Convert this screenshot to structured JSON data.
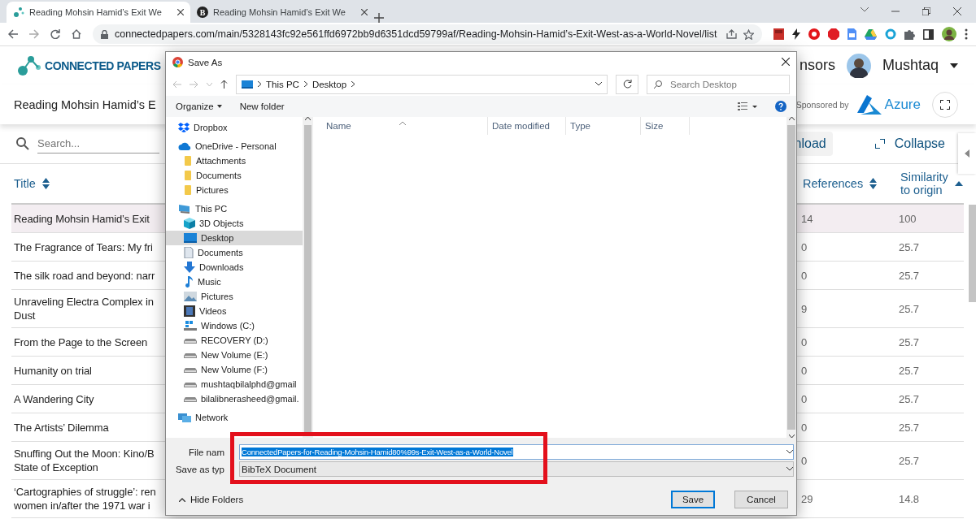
{
  "browser": {
    "tabs": [
      {
        "title": "Reading Mohsin Hamid’s Exit We",
        "selected": true,
        "kind": "graph"
      },
      {
        "title": "Reading Mohsin Hamid’s Exit We",
        "selected": false,
        "kind": "letter",
        "favicon_text": "B"
      }
    ],
    "url": "connectedpapers.com/main/5328143fc92e561ffd6972bb9d6351dcd59799af/Reading-Mohsin-Hamid’s-Exit-West-as-a-World-Novel/list"
  },
  "site": {
    "logo": "CONNECTED PAPERS",
    "nav_link": "nsors",
    "user": "Mushtaq",
    "graph_title": "Reading Mohsin Hamid’s E",
    "sponsor_label": "Sponsored by",
    "sponsor": "Azure",
    "search_placeholder": "Search...",
    "download_button": "nload",
    "collapse_button": "Collapse"
  },
  "table": {
    "columns": [
      {
        "label": "Title",
        "sorted": false
      },
      {
        "label": "References",
        "sorted": false
      },
      {
        "label": "Similarity to origin",
        "sorted": true
      }
    ],
    "rows": [
      {
        "title_lines": [
          "Reading Mohsin Hamid’s Exit"
        ],
        "references": "14",
        "similarity": "100",
        "selected": true
      },
      {
        "title_lines": [
          "The Fragrance of Tears: My fri"
        ],
        "references": "0",
        "similarity": "25.7",
        "selected": false
      },
      {
        "title_lines": [
          "The silk road and beyond: narr"
        ],
        "references": "0",
        "similarity": "25.7",
        "selected": false
      },
      {
        "title_lines": [
          "Unraveling Electra Complex in",
          "Dust"
        ],
        "references": "9",
        "similarity": "25.7",
        "selected": false
      },
      {
        "title_lines": [
          "From the Page to the Screen"
        ],
        "references": "0",
        "similarity": "25.7",
        "selected": false
      },
      {
        "title_lines": [
          "Humanity on trial"
        ],
        "references": "0",
        "similarity": "25.7",
        "selected": false
      },
      {
        "title_lines": [
          "A Wandering City"
        ],
        "references": "0",
        "similarity": "25.7",
        "selected": false
      },
      {
        "title_lines": [
          "The Artists’ Dilemma"
        ],
        "references": "0",
        "similarity": "25.7",
        "selected": false
      },
      {
        "title_lines": [
          "Snuffing Out the Moon: Kino/B",
          "State of Exception"
        ],
        "references": "0",
        "similarity": "25.7",
        "selected": false
      },
      {
        "title_lines": [
          "‘Cartographies of struggle’: ren",
          "women in/after the 1971 war i"
        ],
        "references": "29",
        "similarity": "14.8",
        "selected": false
      }
    ]
  },
  "dialog": {
    "title": "Save As",
    "path": [
      "This PC",
      "Desktop"
    ],
    "search_placeholder": "Search Desktop",
    "toolbar": [
      "Organize",
      "New folder"
    ],
    "tree": [
      {
        "label": "Dropbox",
        "kind": "dropbox",
        "selected": false
      },
      {
        "label": "OneDrive - Personal",
        "kind": "cloud",
        "selected": false,
        "children": [
          {
            "label": "Attachments",
            "kind": "folder",
            "selected": false
          },
          {
            "label": "Documents",
            "kind": "folder",
            "selected": false
          },
          {
            "label": "Pictures",
            "kind": "folder",
            "selected": false
          }
        ]
      },
      {
        "label": "This PC",
        "kind": "pc",
        "selected": false,
        "children": [
          {
            "label": "3D Objects",
            "kind": "cube",
            "selected": false
          },
          {
            "label": "Desktop",
            "kind": "desktop",
            "selected": true
          },
          {
            "label": "Documents",
            "kind": "document",
            "selected": false
          },
          {
            "label": "Downloads",
            "kind": "download",
            "selected": false
          },
          {
            "label": "Music",
            "kind": "music",
            "selected": false
          },
          {
            "label": "Pictures",
            "kind": "pictures",
            "selected": false
          },
          {
            "label": "Videos",
            "kind": "videos",
            "selected": false
          },
          {
            "label": "Windows (C:)",
            "kind": "windows-drive",
            "selected": false
          },
          {
            "label": "RECOVERY (D:)",
            "kind": "drive",
            "selected": false
          },
          {
            "label": "New Volume (E:)",
            "kind": "drive",
            "selected": false
          },
          {
            "label": "New Volume (F:)",
            "kind": "drive",
            "selected": false
          },
          {
            "label": "mushtaqbilalphd@gmail",
            "kind": "drive",
            "selected": false
          },
          {
            "label": "bilalibnerasheed@gmail.",
            "kind": "drive",
            "selected": false
          }
        ]
      },
      {
        "label": "Network",
        "kind": "network",
        "selected": false
      }
    ],
    "columns": [
      "Name",
      "Date modified",
      "Type",
      "Size"
    ],
    "file_name_label": "File nam",
    "file_name": "ConnectedPapers-for-Reading-Mohsin-Hamid80%99s-Exit-West-as-a-World-Novel",
    "type_label": "Save as typ",
    "file_type": "BibTeX Document",
    "hide_folders": "Hide Folders",
    "buttons": [
      {
        "label": "Save",
        "kind": "primary"
      },
      {
        "label": "Cancel",
        "kind": "normal"
      }
    ]
  }
}
